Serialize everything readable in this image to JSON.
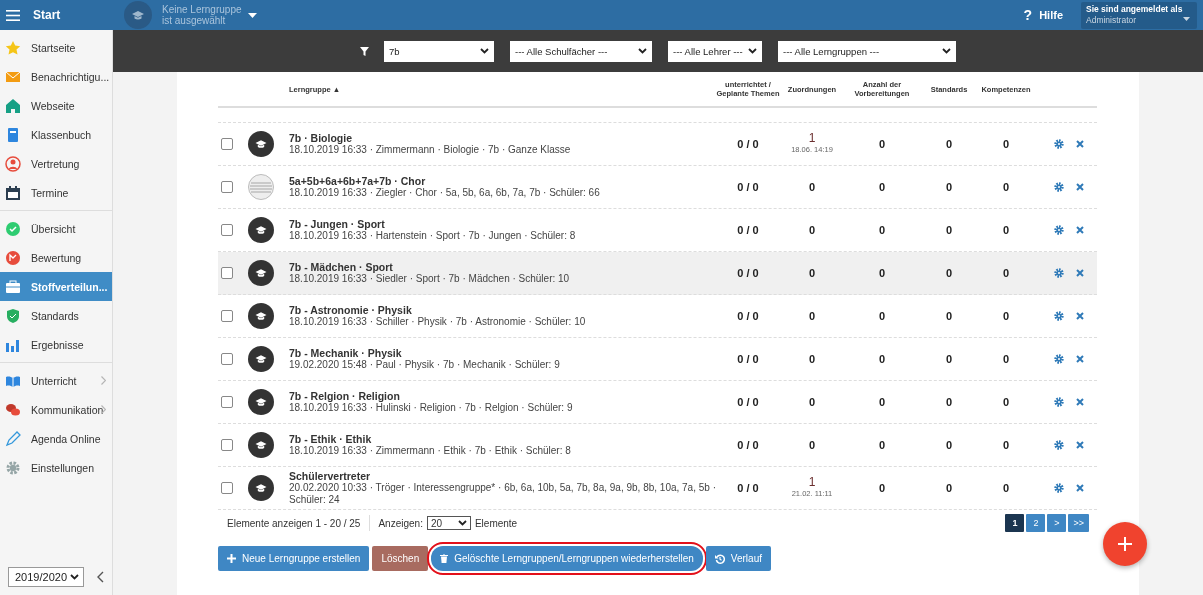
{
  "topbar": {
    "title": "Start",
    "group_line1": "Keine Lerngruppe",
    "group_line2": "ist ausgewählt",
    "help_glyph": "?",
    "help": "Hilfe",
    "user_caption": "Sie sind angemeldet als",
    "user": "Administrator"
  },
  "sidebar": {
    "sections": [
      [
        {
          "label": "Startseite",
          "selected": false,
          "submenu": false
        },
        {
          "label": "Benachrichtigu...",
          "selected": false,
          "submenu": false
        },
        {
          "label": "Webseite",
          "selected": false,
          "submenu": false
        },
        {
          "label": "Klassenbuch",
          "selected": false,
          "submenu": false
        },
        {
          "label": "Vertretung",
          "selected": false,
          "submenu": false
        },
        {
          "label": "Termine",
          "selected": false,
          "submenu": false
        }
      ],
      [
        {
          "label": "Übersicht",
          "selected": false,
          "submenu": false
        },
        {
          "label": "Bewertung",
          "selected": false,
          "submenu": false
        },
        {
          "label": "Stoffverteilun...",
          "selected": true,
          "submenu": false
        },
        {
          "label": "Standards",
          "selected": false,
          "submenu": false
        },
        {
          "label": "Ergebnisse",
          "selected": false,
          "submenu": false
        }
      ],
      [
        {
          "label": "Unterricht",
          "selected": false,
          "submenu": true
        },
        {
          "label": "Kommunikation",
          "selected": false,
          "submenu": true
        },
        {
          "label": "Agenda Online",
          "selected": false,
          "submenu": false
        },
        {
          "label": "Einstellungen",
          "selected": false,
          "submenu": false
        }
      ]
    ],
    "year": "2019/2020"
  },
  "filters": [
    {
      "value": "7b"
    },
    {
      "value": "--- Alle Schulfächer ---"
    },
    {
      "value": "--- Alle Lehrer ---"
    },
    {
      "value": "--- Alle Lerngruppen ---"
    }
  ],
  "table": {
    "columns": [
      "Lerngruppe ▲",
      "unterrichtet / Geplante Themen",
      "Zuordnungen",
      "Anzahl der Vorbereitungen",
      "Standards",
      "Kompetenzen"
    ],
    "rows": [
      {
        "kind": "cap",
        "title": "7b · Biologie",
        "details": "18.10.2019 16:33 · Zimmermann · Biologie · 7b · Ganze Klasse",
        "checked": false,
        "highlighted": false,
        "taught": "0 / 0",
        "assignments": "1",
        "assignments_date": "18.06. 14:19",
        "preparations": "0",
        "standards": "0",
        "competences": "0"
      },
      {
        "kind": "sheet",
        "title": "5a+5b+6a+6b+7a+7b · Chor",
        "details": "18.10.2019 16:33 · Ziegler · Chor · 5a, 5b, 6a, 6b, 7a, 7b · Schüler: 66",
        "checked": false,
        "highlighted": false,
        "taught": "0 / 0",
        "assignments": "0",
        "preparations": "0",
        "standards": "0",
        "competences": "0"
      },
      {
        "kind": "cap",
        "title": "7b - Jungen · Sport",
        "details": "18.10.2019 16:33 · Hartenstein · Sport · 7b · Jungen · Schüler: 8",
        "checked": false,
        "highlighted": false,
        "taught": "0 / 0",
        "assignments": "0",
        "preparations": "0",
        "standards": "0",
        "competences": "0"
      },
      {
        "kind": "cap",
        "title": "7b - Mädchen · Sport",
        "details": "18.10.2019 16:33 · Siedler · Sport · 7b · Mädchen · Schüler: 10",
        "checked": false,
        "highlighted": true,
        "taught": "0 / 0",
        "assignments": "0",
        "preparations": "0",
        "standards": "0",
        "competences": "0"
      },
      {
        "kind": "cap",
        "title": "7b - Astronomie · Physik",
        "details": "18.10.2019 16:33 · Schiller · Physik · 7b · Astronomie · Schüler: 10",
        "checked": false,
        "highlighted": false,
        "taught": "0 / 0",
        "assignments": "0",
        "preparations": "0",
        "standards": "0",
        "competences": "0"
      },
      {
        "kind": "cap",
        "title": "7b - Mechanik · Physik",
        "details": "19.02.2020 15:48 · Paul · Physik · 7b · Mechanik · Schüler: 9",
        "checked": false,
        "highlighted": false,
        "taught": "0 / 0",
        "assignments": "0",
        "preparations": "0",
        "standards": "0",
        "competences": "0"
      },
      {
        "kind": "cap",
        "title": "7b - Relgion · Religion",
        "details": "18.10.2019 16:33 · Hulinski · Religion · 7b · Relgion · Schüler: 9",
        "checked": false,
        "highlighted": false,
        "taught": "0 / 0",
        "assignments": "0",
        "preparations": "0",
        "standards": "0",
        "competences": "0"
      },
      {
        "kind": "cap",
        "title": "7b - Ethik · Ethik",
        "details": "18.10.2019 16:33 · Zimmermann · Ethik · 7b · Ethik · Schüler: 8",
        "checked": false,
        "highlighted": false,
        "taught": "0 / 0",
        "assignments": "0",
        "preparations": "0",
        "standards": "0",
        "competences": "0"
      },
      {
        "kind": "cap",
        "title": "Schülervertreter",
        "details": "20.02.2020 10:33 · Tröger · Interessengruppe* · 6b, 6a, 10b, 5a, 7b, 8a, 9a, 9b, 8b, 10a, 7a, 5b · Schüler: 24",
        "checked": false,
        "highlighted": false,
        "taught": "0 / 0",
        "assignments": "1",
        "assignments_date": "21.02. 11:11",
        "preparations": "0",
        "standards": "0",
        "competences": "0"
      }
    ]
  },
  "footer": {
    "range": "Elemente anzeigen 1 - 20 / 25",
    "show_label": "Anzeigen:",
    "page_size": "20",
    "suffix": "Elemente",
    "pages": [
      {
        "label": "1",
        "selected": true
      },
      {
        "label": "2",
        "selected": false
      },
      {
        "label": ">",
        "selected": false
      },
      {
        "label": ">>",
        "selected": false
      }
    ]
  },
  "buttons": [
    {
      "kind": "primary",
      "label": "Neue Lerngruppe erstellen",
      "circled": false
    },
    {
      "kind": "danger",
      "label": "Löschen",
      "circled": false
    },
    {
      "kind": "primary",
      "label": "Gelöschte Lerngruppen/Lerngruppen wiederherstellen",
      "circled": true
    },
    {
      "kind": "primary",
      "label": "Verlauf",
      "circled": false
    }
  ]
}
